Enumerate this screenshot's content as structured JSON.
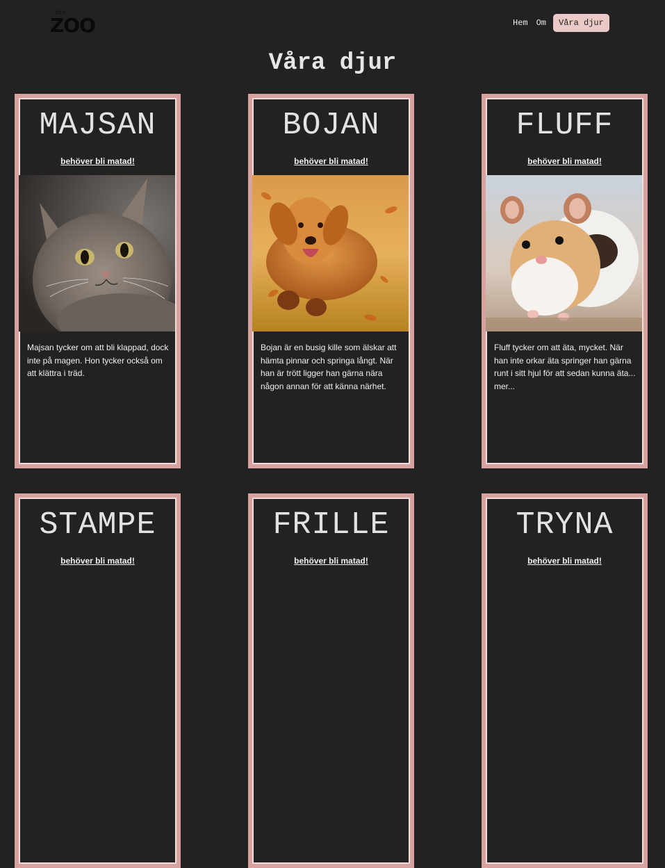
{
  "logo": {
    "small": "the",
    "big": "ZOO"
  },
  "nav": {
    "items": [
      {
        "label": "Hem"
      },
      {
        "label": "Om"
      },
      {
        "label": "Våra djur"
      }
    ]
  },
  "page_title": "Våra djur",
  "colors": {
    "background": "#222222",
    "card_border": "#d7a29f",
    "nav_active": "#ebc9c7"
  },
  "animals": [
    {
      "name": "MAJSAN",
      "status": "behöver bli matad!",
      "photo": "cat-photo",
      "description": "Majsan tycker om att bli klappad, dock inte på magen. Hon tycker också om att klättra i träd."
    },
    {
      "name": "BOJAN",
      "status": "behöver bli matad!",
      "photo": "dog-photo",
      "description": "Bojan är en busig kille som älskar att hämta pinnar och springa långt. När han är trött ligger han gärna nära någon annan för att känna närhet."
    },
    {
      "name": "FLUFF",
      "status": "behöver bli matad!",
      "photo": "hamster-photo",
      "description": "Fluff tycker om att äta, mycket. När han inte orkar äta springer han gärna runt i sitt hjul för att sedan kunna äta... mer..."
    },
    {
      "name": "STAMPE",
      "status": "behöver bli matad!"
    },
    {
      "name": "FRILLE",
      "status": "behöver bli matad!"
    },
    {
      "name": "TRYNA",
      "status": "behöver bli matad!"
    }
  ]
}
